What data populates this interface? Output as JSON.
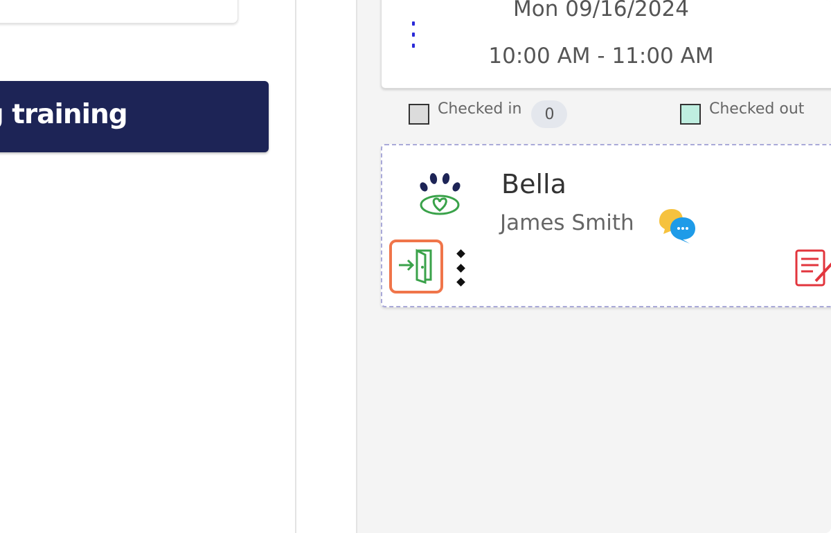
{
  "left_panel": {
    "service_label": "og training"
  },
  "appointment": {
    "date": "Mon 09/16/2024",
    "time": "10:00 AM - 11:00 AM"
  },
  "legend": {
    "checked_in_label": "Checked in",
    "checked_in_count": "0",
    "checked_in_color": "#dcdcdc",
    "checked_out_label": "Checked out",
    "checked_out_color": "#bfeee0"
  },
  "pet_card": {
    "pet_name": "Bella",
    "owner_name": "James Smith",
    "logo_icon": "paw-heart-icon",
    "chat_icon": "chat-bubbles-icon",
    "checkin_icon": "door-enter-icon",
    "notes_icon": "notes-edit-icon",
    "highlight_color": "#f0754a"
  }
}
